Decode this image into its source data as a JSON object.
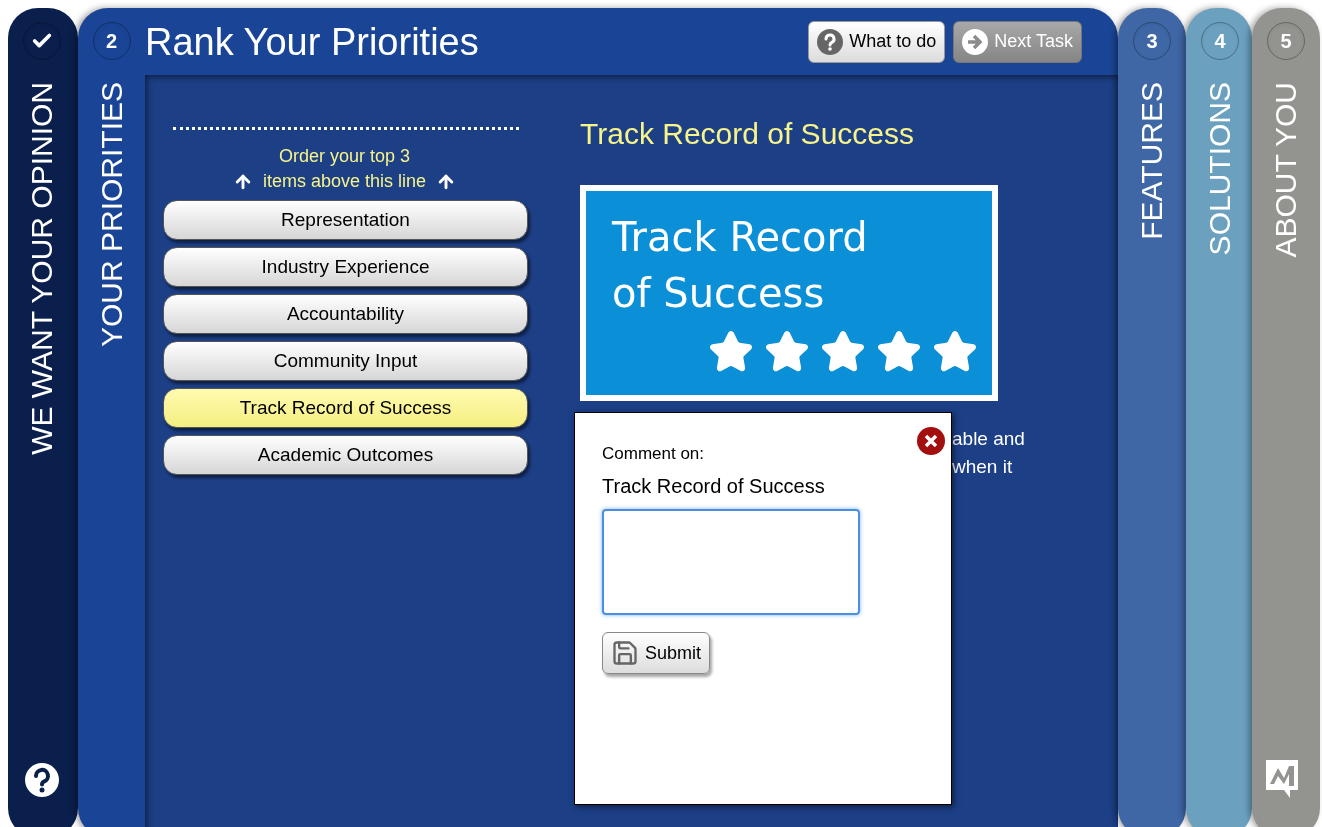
{
  "steps": [
    {
      "kind": "done",
      "label": "WE WANT YOUR OPINION",
      "color": "#0b1f4d"
    },
    {
      "kind": "active",
      "number": "2",
      "label": "YOUR PRIORITIES",
      "color": "#1a4596"
    },
    {
      "kind": "upcoming",
      "number": "3",
      "label": "FEATURES",
      "color": "#3f67a6"
    },
    {
      "kind": "upcoming",
      "number": "4",
      "label": "SOLUTIONS",
      "color": "#6ba1bf"
    },
    {
      "kind": "upcoming",
      "number": "5",
      "label": "ABOUT YOU",
      "color": "#93948f"
    }
  ],
  "header": {
    "title": "Rank Your Priorities",
    "buttons": [
      {
        "kind": "help",
        "label": "What to do"
      },
      {
        "kind": "next",
        "label": "Next Task"
      }
    ]
  },
  "ranking": {
    "instruction": [
      "Order your top 3",
      "items above this line"
    ],
    "items": [
      {
        "label": "Representation",
        "selected": false
      },
      {
        "label": "Industry Experience",
        "selected": false
      },
      {
        "label": "Accountability",
        "selected": false
      },
      {
        "label": "Community Input",
        "selected": false
      },
      {
        "label": "Track Record of Success",
        "selected": true
      },
      {
        "label": "Academic Outcomes",
        "selected": false
      }
    ]
  },
  "detail": {
    "title": "Track Record of Success",
    "image": {
      "lines": [
        "Track Record",
        "of Success"
      ],
      "stars": 5
    },
    "description_visible": [
      "able and",
      "when it"
    ]
  },
  "comment_dialog": {
    "label": "Comment on:",
    "subject": "Track Record of Success",
    "button": "Submit"
  }
}
